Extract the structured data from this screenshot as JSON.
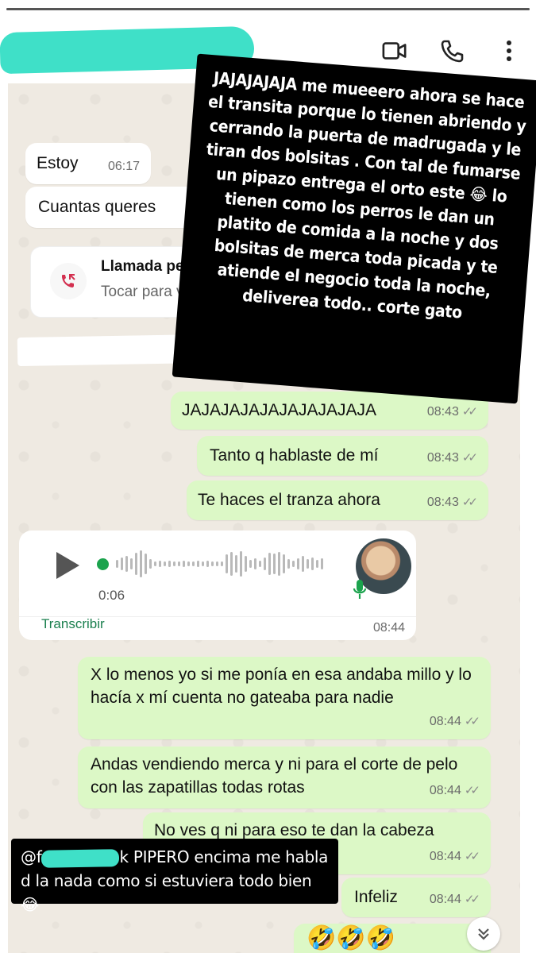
{
  "story": {
    "progress": 1.0
  },
  "header": {
    "icons": [
      "video-call-icon",
      "phone-call-icon",
      "more-options-icon"
    ]
  },
  "messages": {
    "in_1": {
      "text": "Estoy",
      "time": "06:17"
    },
    "in_2": {
      "text": "Cuantas queres"
    },
    "call": {
      "title": "Llamada per",
      "subtitle": "Tocar para v"
    },
    "out_1": {
      "text": "JAJAJAJAJAJAJAJAJAJA",
      "time": "08:43"
    },
    "out_2": {
      "text": "Tanto q hablaste de mí",
      "time": "08:43"
    },
    "out_3": {
      "text": "Te haces el tranza ahora",
      "time": "08:43"
    },
    "voice": {
      "duration": "0:06",
      "transcribe": "Transcribir",
      "time": "08:44"
    },
    "out_4": {
      "text": "X lo menos yo si me ponía en esa andaba millo y lo hacía x mí cuenta no gateaba para nadie",
      "time": "08:44"
    },
    "out_5": {
      "text": "Andas vendiendo merca y ni para el corte de pelo con las zapatillas todas rotas",
      "time": "08:44"
    },
    "out_6": {
      "text": "No ves q ni para eso te dan la cabeza",
      "time": "08:44"
    },
    "out_7": {
      "text": "Infeliz",
      "time": "08:44"
    },
    "out_8": {
      "text": "🤣🤣🤣"
    }
  },
  "overlay": {
    "main_text": "JAJAJAJAJA me mueeero ahora se hace el transita porque lo tienen abriendo y cerrando la puerta de madrugada y le tiran dos bolsitas . Con tal de fumarse un pipazo entrega el orto este 😂 lo tienen como los perros le dan un platito de comida a la noche y dos bolsitas de merca toda picada y te atiende el negocio toda la noche, deliverea todo.. corte gato",
    "bottom_prefix": "@f",
    "bottom_mention_end": "k",
    "bottom_text": "PIPERO encima me habla d la nada como si estuviera todo bien 😂"
  },
  "colors": {
    "chat_bg": "#efeae2",
    "outgoing_bubble": "#dcf8c6",
    "incoming_bubble": "#ffffff",
    "redaction": "#3fe0c8",
    "accent_green": "#1ba34d"
  }
}
